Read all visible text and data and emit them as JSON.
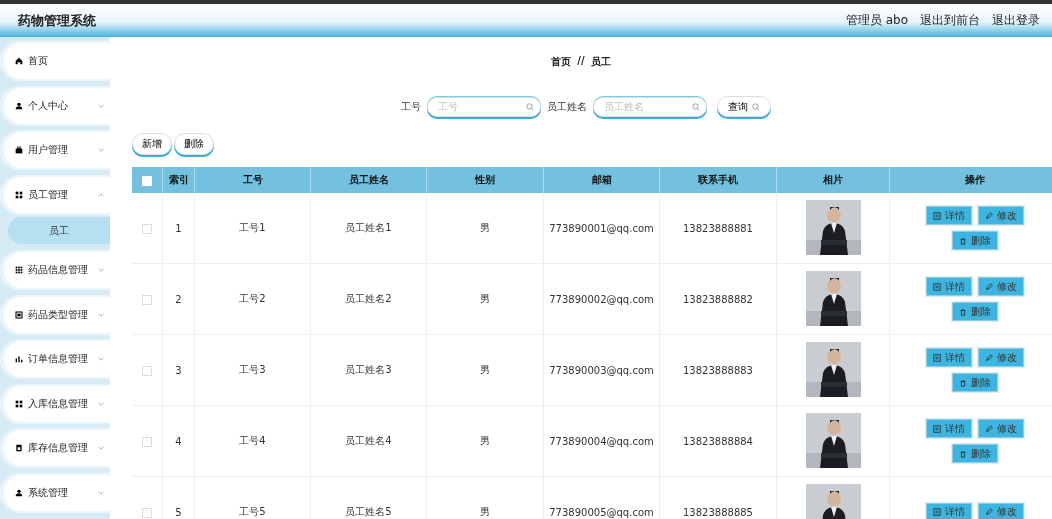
{
  "header": {
    "title": "药物管理系统",
    "user": "管理员 abo",
    "links": [
      "退出到前台",
      "退出登录"
    ]
  },
  "sidebar": {
    "items": [
      {
        "label": "首页",
        "kind": "link"
      },
      {
        "label": "个人中心",
        "kind": "menu",
        "expanded": false
      },
      {
        "label": "用户管理",
        "kind": "menu",
        "expanded": false
      },
      {
        "label": "员工管理",
        "kind": "menu",
        "expanded": true,
        "children": [
          {
            "label": "员工",
            "selected": true
          }
        ]
      },
      {
        "label": "药品信息管理",
        "kind": "menu",
        "expanded": false
      },
      {
        "label": "药品类型管理",
        "kind": "menu",
        "expanded": false
      },
      {
        "label": "订单信息管理",
        "kind": "menu",
        "expanded": false
      },
      {
        "label": "入库信息管理",
        "kind": "menu",
        "expanded": false
      },
      {
        "label": "库存信息管理",
        "kind": "menu",
        "expanded": false
      },
      {
        "label": "系统管理",
        "kind": "menu",
        "expanded": false
      }
    ]
  },
  "breadcrumb": [
    "首页",
    "//",
    "员工"
  ],
  "search": {
    "fields": [
      {
        "label": "工号",
        "placeholder": "工号"
      },
      {
        "label": "员工姓名",
        "placeholder": "员工姓名"
      }
    ],
    "button": "查询"
  },
  "actions": [
    "新增",
    "删除"
  ],
  "table": {
    "columns": [
      "索引",
      "工号",
      "员工姓名",
      "性别",
      "邮箱",
      "联系手机",
      "相片",
      "操作"
    ],
    "header_checked": false,
    "rows": [
      {
        "checked": false,
        "cells": [
          "1",
          "工号1",
          "员工姓名1",
          "男",
          "773890001@qq.com",
          "13823888881"
        ],
        "photo": {
          "kind": "picture"
        },
        "buttons": [
          "详情",
          "修改",
          "删除"
        ]
      },
      {
        "checked": false,
        "cells": [
          "2",
          "工号2",
          "员工姓名2",
          "男",
          "773890002@qq.com",
          "13823888882"
        ],
        "photo": {
          "kind": "picture"
        },
        "buttons": [
          "详情",
          "修改",
          "删除"
        ]
      },
      {
        "checked": false,
        "cells": [
          "3",
          "工号3",
          "员工姓名3",
          "男",
          "773890003@qq.com",
          "13823888883"
        ],
        "photo": {
          "kind": "picture"
        },
        "buttons": [
          "详情",
          "修改",
          "删除"
        ]
      },
      {
        "checked": false,
        "cells": [
          "4",
          "工号4",
          "员工姓名4",
          "男",
          "773890004@qq.com",
          "13823888884"
        ],
        "photo": {
          "kind": "picture"
        },
        "buttons": [
          "详情",
          "修改",
          "删除"
        ]
      },
      {
        "checked": false,
        "cells": [
          "5",
          "工号5",
          "员工姓名5",
          "男",
          "773890005@qq.com",
          "13823888885"
        ],
        "photo": {
          "kind": "picture"
        },
        "buttons": [
          "详情",
          "修改"
        ]
      }
    ]
  }
}
